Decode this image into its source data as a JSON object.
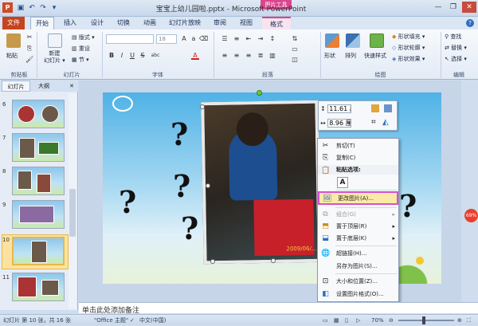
{
  "window": {
    "title": "宝宝上幼儿园啦.pptx - Microsoft PowerPoint",
    "contextual_tab_group": "图片工具",
    "qat_icons": [
      "save-icon",
      "undo-icon",
      "redo-icon",
      "customize-qat-icon"
    ],
    "controls": {
      "minimize": "—",
      "restore": "❐",
      "close": "✕"
    }
  },
  "ribbon_tabs": [
    "文件",
    "开始",
    "插入",
    "设计",
    "切换",
    "动画",
    "幻灯片放映",
    "审阅",
    "视图",
    "格式"
  ],
  "ribbon": {
    "clipboard": {
      "label": "剪贴板",
      "paste": "粘贴"
    },
    "slides": {
      "label": "幻灯片",
      "new_slide": "新建\n幻灯片",
      "layout": "版式",
      "reset": "重设",
      "section": "节"
    },
    "font": {
      "label": "字体",
      "font_size": "18",
      "bold": "B",
      "italic": "I",
      "underline": "U",
      "strike": "S",
      "shadow": "abc"
    },
    "paragraph": {
      "label": "段落"
    },
    "drawing": {
      "label": "绘图",
      "shapes": "形状",
      "arrange": "排列",
      "quick_styles": "快速样式",
      "fill": "形状填充",
      "outline": "形状轮廓",
      "effects": "形状效果"
    },
    "editing": {
      "label": "编辑",
      "find": "查找",
      "replace": "替换",
      "select": "选择"
    }
  },
  "left_pane": {
    "tabs": [
      "幻灯片",
      "大纲"
    ],
    "close_icon": "✕",
    "slides": [
      {
        "num": "6"
      },
      {
        "num": "7"
      },
      {
        "num": "8"
      },
      {
        "num": "9"
      },
      {
        "num": "10"
      },
      {
        "num": "11"
      }
    ]
  },
  "mini_toolbar": {
    "height_value": "11.61 厘米",
    "width_value": "8.96 厘米"
  },
  "context_menu": {
    "items": [
      {
        "label": "剪切(T)",
        "icon": "scissors-icon"
      },
      {
        "label": "复制(C)",
        "icon": "copy-icon"
      },
      {
        "label": "粘贴选项:",
        "icon": "paste-icon"
      },
      {
        "label": "A",
        "icon": "paste-text-icon"
      },
      {
        "label": "更改图片(A)...",
        "icon": "change-picture-icon"
      },
      {
        "label": "组合(G)",
        "icon": "group-icon"
      },
      {
        "label": "置于顶层(R)",
        "icon": "bring-front-icon"
      },
      {
        "label": "置于底层(K)",
        "icon": "send-back-icon"
      },
      {
        "label": "超链接(H)...",
        "icon": "hyperlink-icon"
      },
      {
        "label": "另存为图片(S)...",
        "icon": "save-picture-icon"
      },
      {
        "label": "大小和位置(Z)...",
        "icon": "size-position-icon"
      },
      {
        "label": "设置图片格式(O)...",
        "icon": "format-picture-icon"
      }
    ]
  },
  "slide": {
    "photo_stamp": "2009/06/..."
  },
  "notes_placeholder": "单击此处添加备注",
  "status": {
    "slide_info": "幻灯片 第 10 张，共 16 张",
    "theme": "\"Office 主题\"",
    "language": "中文(中国)",
    "zoom": "70%"
  },
  "side_badge": "69%",
  "colors": {
    "file_tab": "#c5441d",
    "contextual": "#d9468f",
    "highlight_border": "#d64fd0"
  }
}
